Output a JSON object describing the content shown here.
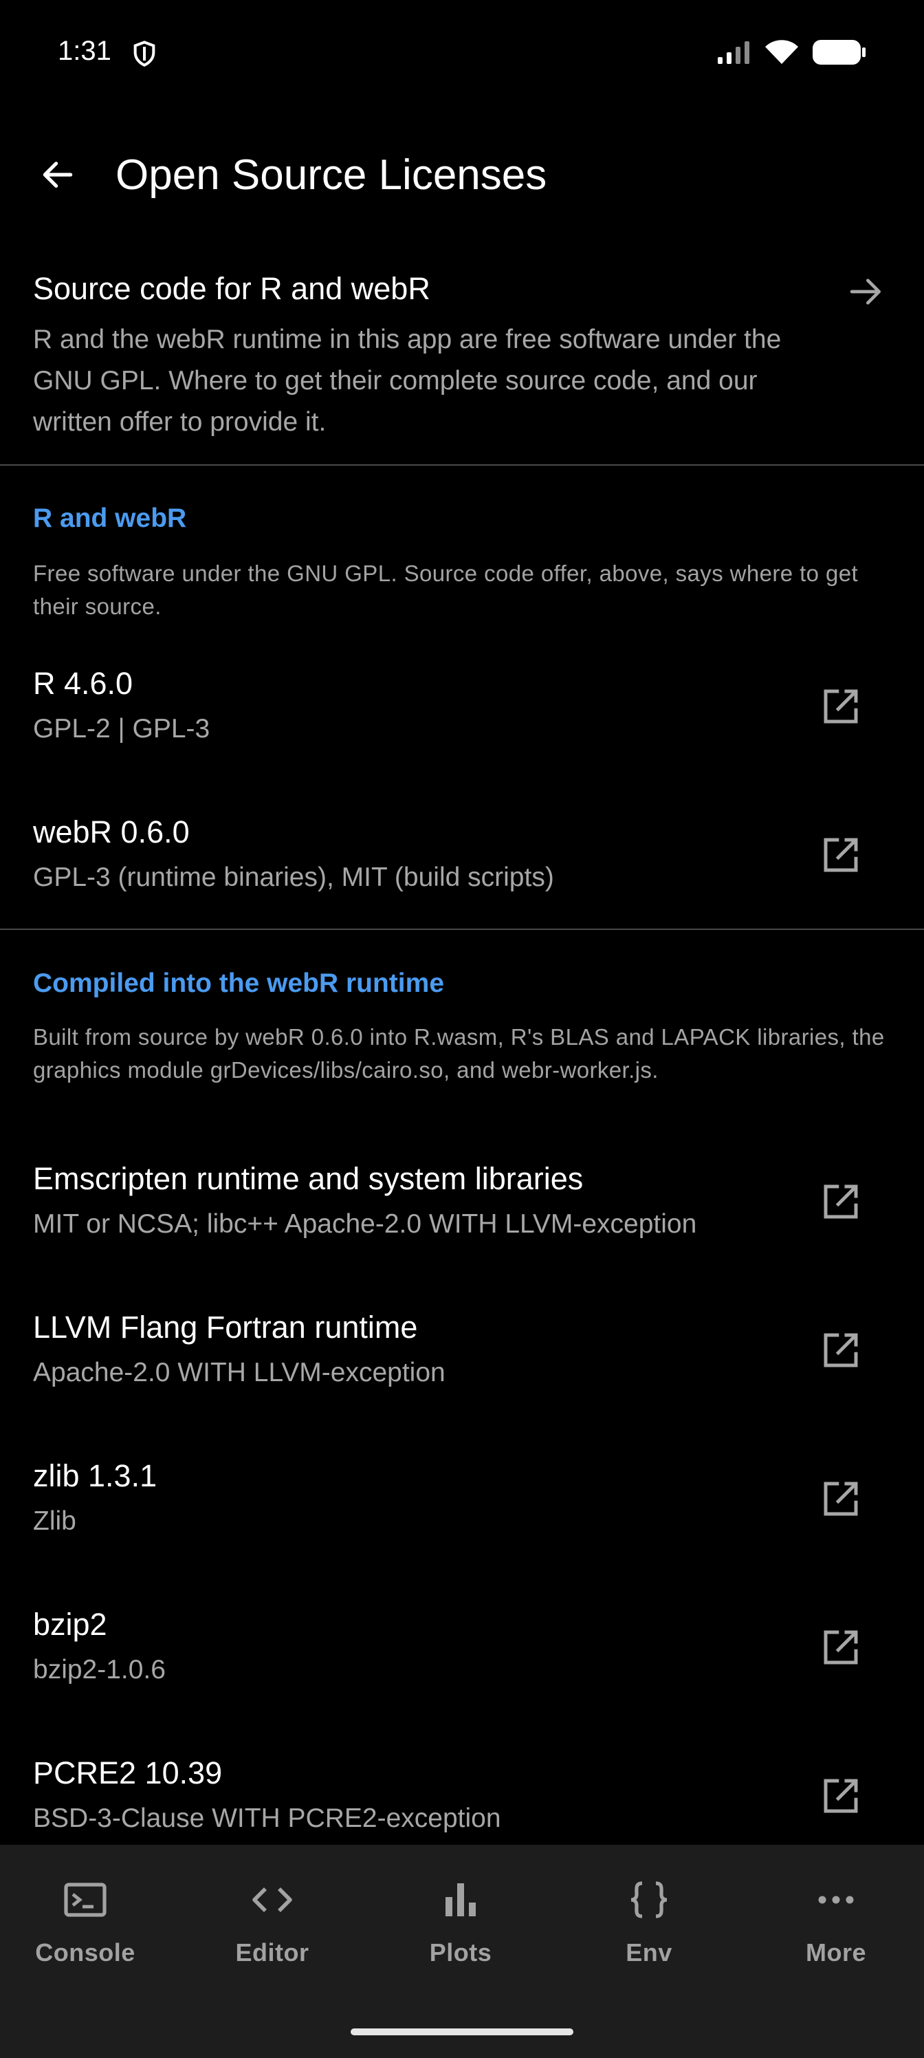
{
  "status": {
    "time": "1:31"
  },
  "header": {
    "title": "Open Source Licenses"
  },
  "source_offer": {
    "title": "Source code for R and webR",
    "description": "R and the webR runtime in this app are free software under the GNU GPL. Where to get their complete source code, and our written offer to provide it."
  },
  "sections": [
    {
      "header": "R and webR",
      "description": "Free software under the GNU GPL. Source code offer, above, says where to get their source.",
      "items": [
        {
          "name": "R 4.6.0",
          "license": "GPL-2 | GPL-3"
        },
        {
          "name": "webR 0.6.0",
          "license": "GPL-3 (runtime binaries), MIT (build scripts)"
        }
      ]
    },
    {
      "header": "Compiled into the webR runtime",
      "description": "Built from source by webR 0.6.0 into R.wasm, R's BLAS and LAPACK libraries, the graphics module grDevices/libs/cairo.so, and webr-worker.js.",
      "items": [
        {
          "name": "Emscripten runtime and system libraries",
          "license": "MIT or NCSA; libc++ Apache-2.0 WITH LLVM-exception"
        },
        {
          "name": "LLVM Flang Fortran runtime",
          "license": "Apache-2.0 WITH LLVM-exception"
        },
        {
          "name": "zlib 1.3.1",
          "license": "Zlib"
        },
        {
          "name": "bzip2",
          "license": "bzip2-1.0.6"
        },
        {
          "name": "PCRE2 10.39",
          "license": "BSD-3-Clause WITH PCRE2-exception"
        }
      ]
    }
  ],
  "nav": [
    {
      "label": "Console",
      "icon": "console-icon"
    },
    {
      "label": "Editor",
      "icon": "code-icon"
    },
    {
      "label": "Plots",
      "icon": "bar-chart-icon"
    },
    {
      "label": "Env",
      "icon": "braces-icon"
    },
    {
      "label": "More",
      "icon": "more-horiz-icon"
    }
  ],
  "colors": {
    "background": "#000000",
    "accent": "#4b9bf0",
    "secondary_text": "#a7a7a7",
    "nav_background": "#1d1d1d"
  }
}
